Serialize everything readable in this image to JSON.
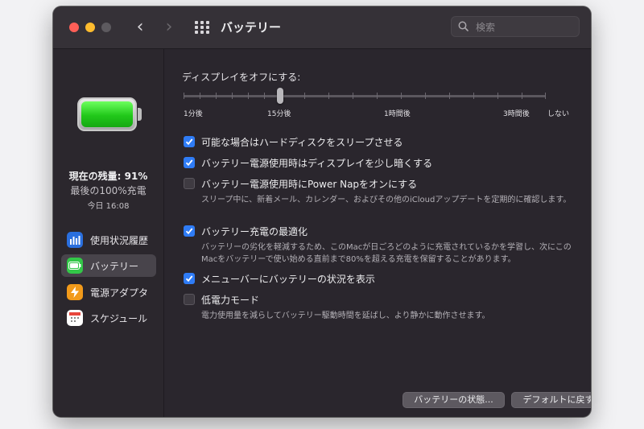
{
  "window": {
    "title": "バッテリー",
    "search": {
      "placeholder": "検索"
    }
  },
  "sidebar": {
    "charge_now": "現在の残量: 91%",
    "charge_full": "最後の100%充電",
    "charge_time": "今日 16:08",
    "battery_level_percent": 91,
    "items": [
      {
        "label": "使用状況履歴",
        "icon": "bar-chart-icon",
        "color": "#2a6fde"
      },
      {
        "label": "バッテリー",
        "icon": "battery-icon",
        "color": "#33c748",
        "selected": true
      },
      {
        "label": "電源アダプタ",
        "icon": "lightning-icon",
        "color": "#f29a1a"
      },
      {
        "label": "スケジュール",
        "icon": "calendar-icon",
        "color": "#ffffff"
      }
    ]
  },
  "display_off": {
    "label": "ディスプレイをオフにする:",
    "value": "15分後",
    "ticks": [
      "1分後",
      "15分後",
      "1時間後",
      "3時間後",
      "しない"
    ]
  },
  "options": [
    {
      "label": "可能な場合はハードディスクをスリープさせる",
      "checked": true,
      "desc": ""
    },
    {
      "label": "バッテリー電源使用時はディスプレイを少し暗くする",
      "checked": true,
      "desc": ""
    },
    {
      "label": "バッテリー電源使用時にPower Napをオンにする",
      "checked": false,
      "desc": "スリープ中に、新着メール、カレンダー、およびその他のiCloudアップデートを定期的に確認します。"
    },
    {
      "label": "バッテリー充電の最適化",
      "checked": true,
      "desc": "バッテリーの劣化を軽減するため、このMacが日ごろどのように充電されているかを学習し、次にこのMacをバッテリーで使い始める直前まで80%を超える充電を保留することがあります。"
    },
    {
      "label": "メニューバーにバッテリーの状況を表示",
      "checked": true,
      "desc": ""
    },
    {
      "label": "低電力モード",
      "checked": false,
      "desc": "電力使用量を減らしてバッテリー駆動時間を延ばし、より静かに動作させます。"
    }
  ],
  "buttons": {
    "battery_health": "バッテリーの状態...",
    "restore_defaults": "デフォルトに戻す",
    "help": "?"
  },
  "colors": {
    "accent": "#2f7cf6",
    "battery_green": "#21c81a"
  }
}
